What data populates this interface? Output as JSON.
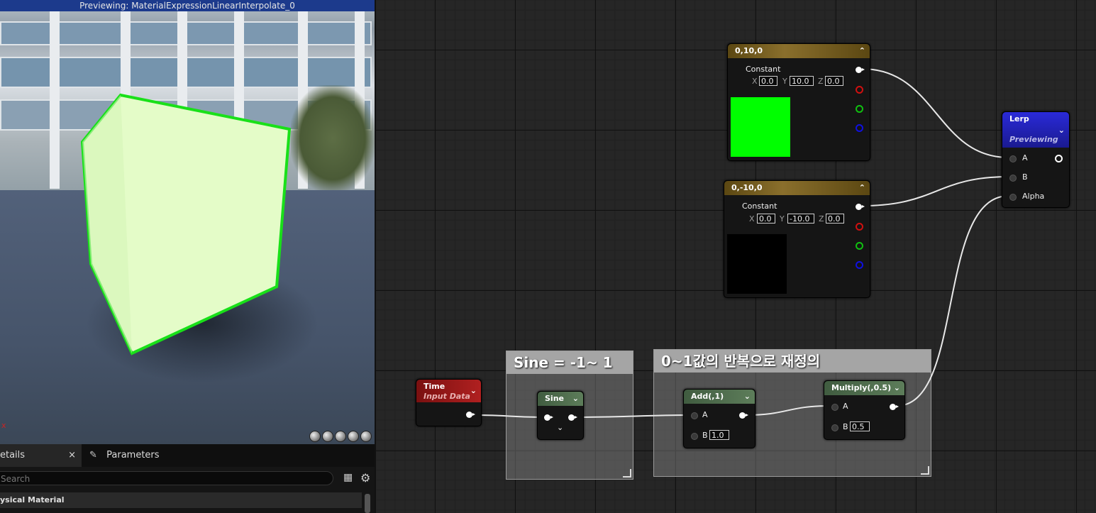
{
  "preview": {
    "title": "Previewing: MaterialExpressionLinearInterpolate_0",
    "axis_label": "x",
    "view_modes": [
      "cylinder-icon",
      "sphere-icon",
      "plane-icon",
      "cube-icon",
      "teapot-icon"
    ]
  },
  "details": {
    "tab_details": "etails",
    "tab_close": "×",
    "tab_parameters": "Parameters",
    "search_placeholder": "Search",
    "category": "ysical Material"
  },
  "graph": {
    "comments": [
      {
        "title": "Sine = -1~ 1"
      },
      {
        "title": "0~1값의 반복으로 재정의"
      }
    ],
    "constant_top": {
      "title": "0,10,0",
      "label": "Constant",
      "x": "0.0",
      "y": "10.0",
      "z": "0.0",
      "swatch_color": "#00ff00"
    },
    "constant_bottom": {
      "title": "0,-10,0",
      "label": "Constant",
      "x": "0.0",
      "y": "-10.0",
      "z": "0.0",
      "swatch_color": "#000000"
    },
    "axis_letters": {
      "x": "X",
      "y": "Y",
      "z": "Z"
    },
    "lerp": {
      "title": "Lerp",
      "subtitle": "Previewing",
      "pins": [
        "A",
        "B",
        "Alpha"
      ]
    },
    "time": {
      "title": "Time",
      "subtitle": "Input Data"
    },
    "sine": {
      "title": "Sine"
    },
    "add": {
      "title": "Add(,1)",
      "pin_a": "A",
      "pin_b": "B",
      "b_value": "1.0"
    },
    "multiply": {
      "title": "Multiply(,0.5)",
      "pin_a": "A",
      "pin_b": "B",
      "b_value": "0.5"
    },
    "colors": {
      "pin_red": "#d01010",
      "pin_green": "#10c010",
      "pin_blue": "#1010e0"
    }
  }
}
